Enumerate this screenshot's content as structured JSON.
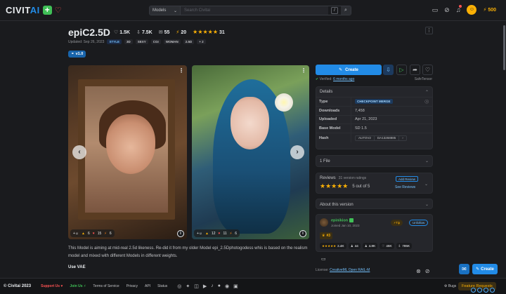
{
  "header": {
    "logo_word_1": "CIVIT",
    "logo_word_2": "AI",
    "logo_plus": "+",
    "logo_heart": "♡",
    "search_filter": "Models",
    "search_placeholder": "Search Civitai",
    "search_shortcut": "/",
    "buzz_amount": "500"
  },
  "model": {
    "title": "epiC2.5D",
    "likes": "1.5K",
    "downloads": "7.5K",
    "comments": "55",
    "buzz": "20",
    "stars": "★★★★★",
    "rating_count": "31",
    "updated": "Updated: Sep 26, 2023",
    "tags": [
      "STYLE",
      "3D",
      "SEXY",
      "CGI",
      "WOMAN",
      "2.5D"
    ],
    "tags_more": "+ 2",
    "version": "v1.0"
  },
  "gallery": {
    "card1": {
      "likes": "6",
      "hearts": "15",
      "buzz": "6"
    },
    "card2": {
      "likes": "12",
      "hearts": "11",
      "buzz": "6"
    }
  },
  "description": {
    "text": "This Model is aiming at mid-real 2.5d likeness. Re-did it from my older Model epi_2.5Dphotogodess whis is based on the realism model and mixed with different Models in different weights.",
    "use_vae": "Use VAE"
  },
  "actions": {
    "create_label": "Create",
    "verified_label": "Verified:",
    "verified_time": "6 months ago",
    "safetensor": "SafeTensor"
  },
  "details": {
    "heading": "Details",
    "rows": [
      {
        "key": "Type",
        "value": "CHECKPOINT MERGE"
      },
      {
        "key": "Downloads",
        "value": "7,458"
      },
      {
        "key": "Uploaded",
        "value": "Apr 21, 2023"
      },
      {
        "key": "Base Model",
        "value": "SD 1.5"
      },
      {
        "key": "Hash",
        "value": "AUTOV2"
      }
    ],
    "hash_value": "DA13268885"
  },
  "files": {
    "label": "1 File"
  },
  "reviews": {
    "heading": "Reviews",
    "count": "31 version ratings",
    "stars": "★★★★★",
    "score": "5 out of 5",
    "add_review": "Add Review",
    "see_reviews": "See Reviews"
  },
  "about": {
    "label": "About this version"
  },
  "creator": {
    "name": "epinikion",
    "joined": "Joined Jan 10, 2023",
    "tip": "Tip",
    "unfollow": "Unfollow",
    "rank": "#3",
    "stats": [
      {
        "icon": "★★★★★",
        "value": "2.4K"
      },
      {
        "icon": "♟",
        "value": "44"
      },
      {
        "icon": "♟",
        "value": "4.9K"
      },
      {
        "icon": "♡",
        "value": "45K"
      },
      {
        "icon": "⇩",
        "value": "785K"
      }
    ]
  },
  "license": {
    "prefix": "License:",
    "link": "CreativeML Open RAIL-M"
  },
  "fab": {
    "create": "Create"
  },
  "footer": {
    "copyright": "© Civitai 2023",
    "support": "Support Us ♥",
    "join": "Join Us ⚡",
    "tos": "Terms of Service",
    "privacy": "Privacy",
    "api": "API",
    "status": "Status",
    "bugs": "Bugs",
    "feature_requests": "Feature Requests"
  },
  "colors": {
    "accent": "#228be6",
    "background": "#1a1b1e",
    "gold": "#fab005",
    "green": "#40c057"
  }
}
